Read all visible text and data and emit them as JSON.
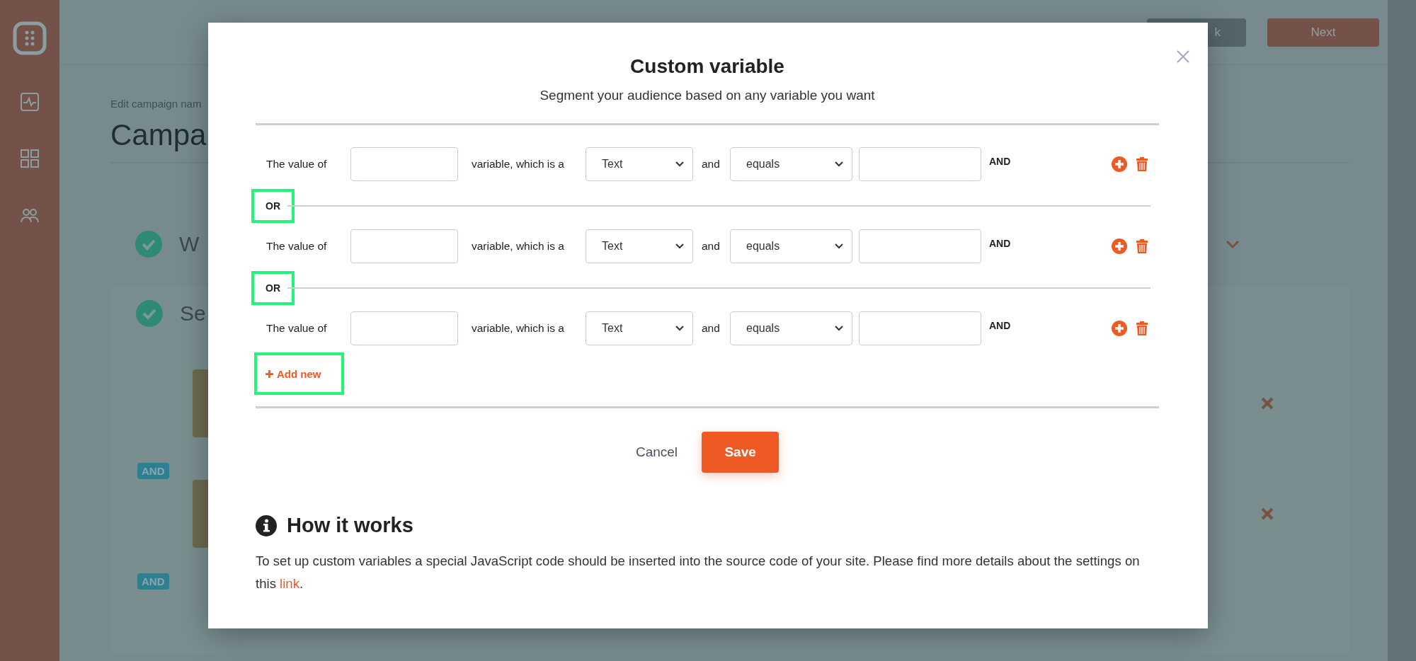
{
  "header": {
    "buttons": [
      {
        "label": "k",
        "kind": "back"
      },
      {
        "label": "Next",
        "kind": "primary"
      }
    ]
  },
  "page": {
    "edit_label": "Edit campaign nam",
    "title": "Campa",
    "steps": [
      {
        "label": "W",
        "done": true
      },
      {
        "label": "Se",
        "done": true
      }
    ],
    "badges": [
      "AND",
      "AND"
    ]
  },
  "modal": {
    "title": "Custom variable",
    "subtitle": "Segment your audience based on any variable you want",
    "conditions": [
      {
        "prefix": "The value of",
        "middle": "variable, which is a",
        "type": "Text",
        "joiner": "and",
        "operator": "equals",
        "suffix": "AND"
      },
      {
        "prefix": "The value of",
        "middle": "variable, which is a",
        "type": "Text",
        "joiner": "and",
        "operator": "equals",
        "suffix": "AND"
      },
      {
        "prefix": "The value of",
        "middle": "variable, which is a",
        "type": "Text",
        "joiner": "and",
        "operator": "equals",
        "suffix": "AND"
      }
    ],
    "connectors": [
      {
        "label": "OR",
        "highlighted": true
      },
      {
        "label": "OR",
        "highlighted": true
      }
    ],
    "add_new": {
      "label": "Add new",
      "highlighted": true
    },
    "buttons": {
      "cancel": "Cancel",
      "save": "Save"
    },
    "help": {
      "title": "How it works",
      "text": "To set up custom variables a special JavaScript code should be inserted into the source code of your site. Please find more details about the settings on this ",
      "link": "link",
      "after": "."
    }
  }
}
